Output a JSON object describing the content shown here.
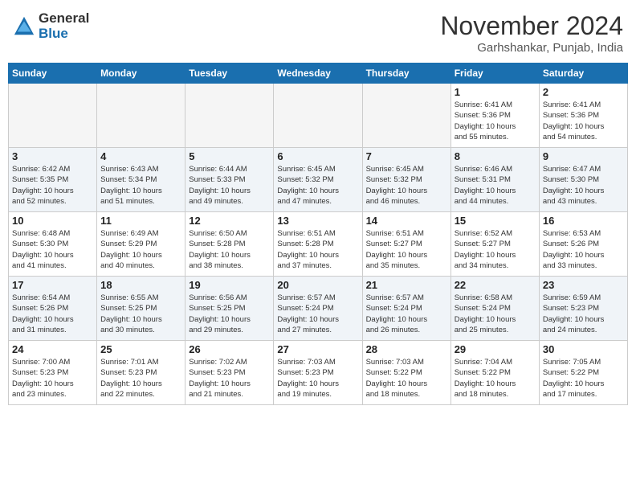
{
  "header": {
    "logo_general": "General",
    "logo_blue": "Blue",
    "month_title": "November 2024",
    "location": "Garhshankar, Punjab, India"
  },
  "weekdays": [
    "Sunday",
    "Monday",
    "Tuesday",
    "Wednesday",
    "Thursday",
    "Friday",
    "Saturday"
  ],
  "weeks": [
    {
      "style": "odd",
      "days": [
        {
          "num": "",
          "info": "",
          "empty": true
        },
        {
          "num": "",
          "info": "",
          "empty": true
        },
        {
          "num": "",
          "info": "",
          "empty": true
        },
        {
          "num": "",
          "info": "",
          "empty": true
        },
        {
          "num": "",
          "info": "",
          "empty": true
        },
        {
          "num": "1",
          "info": "Sunrise: 6:41 AM\nSunset: 5:36 PM\nDaylight: 10 hours\nand 55 minutes.",
          "empty": false
        },
        {
          "num": "2",
          "info": "Sunrise: 6:41 AM\nSunset: 5:36 PM\nDaylight: 10 hours\nand 54 minutes.",
          "empty": false
        }
      ]
    },
    {
      "style": "even",
      "days": [
        {
          "num": "3",
          "info": "Sunrise: 6:42 AM\nSunset: 5:35 PM\nDaylight: 10 hours\nand 52 minutes.",
          "empty": false
        },
        {
          "num": "4",
          "info": "Sunrise: 6:43 AM\nSunset: 5:34 PM\nDaylight: 10 hours\nand 51 minutes.",
          "empty": false
        },
        {
          "num": "5",
          "info": "Sunrise: 6:44 AM\nSunset: 5:33 PM\nDaylight: 10 hours\nand 49 minutes.",
          "empty": false
        },
        {
          "num": "6",
          "info": "Sunrise: 6:45 AM\nSunset: 5:32 PM\nDaylight: 10 hours\nand 47 minutes.",
          "empty": false
        },
        {
          "num": "7",
          "info": "Sunrise: 6:45 AM\nSunset: 5:32 PM\nDaylight: 10 hours\nand 46 minutes.",
          "empty": false
        },
        {
          "num": "8",
          "info": "Sunrise: 6:46 AM\nSunset: 5:31 PM\nDaylight: 10 hours\nand 44 minutes.",
          "empty": false
        },
        {
          "num": "9",
          "info": "Sunrise: 6:47 AM\nSunset: 5:30 PM\nDaylight: 10 hours\nand 43 minutes.",
          "empty": false
        }
      ]
    },
    {
      "style": "odd",
      "days": [
        {
          "num": "10",
          "info": "Sunrise: 6:48 AM\nSunset: 5:30 PM\nDaylight: 10 hours\nand 41 minutes.",
          "empty": false
        },
        {
          "num": "11",
          "info": "Sunrise: 6:49 AM\nSunset: 5:29 PM\nDaylight: 10 hours\nand 40 minutes.",
          "empty": false
        },
        {
          "num": "12",
          "info": "Sunrise: 6:50 AM\nSunset: 5:28 PM\nDaylight: 10 hours\nand 38 minutes.",
          "empty": false
        },
        {
          "num": "13",
          "info": "Sunrise: 6:51 AM\nSunset: 5:28 PM\nDaylight: 10 hours\nand 37 minutes.",
          "empty": false
        },
        {
          "num": "14",
          "info": "Sunrise: 6:51 AM\nSunset: 5:27 PM\nDaylight: 10 hours\nand 35 minutes.",
          "empty": false
        },
        {
          "num": "15",
          "info": "Sunrise: 6:52 AM\nSunset: 5:27 PM\nDaylight: 10 hours\nand 34 minutes.",
          "empty": false
        },
        {
          "num": "16",
          "info": "Sunrise: 6:53 AM\nSunset: 5:26 PM\nDaylight: 10 hours\nand 33 minutes.",
          "empty": false
        }
      ]
    },
    {
      "style": "even",
      "days": [
        {
          "num": "17",
          "info": "Sunrise: 6:54 AM\nSunset: 5:26 PM\nDaylight: 10 hours\nand 31 minutes.",
          "empty": false
        },
        {
          "num": "18",
          "info": "Sunrise: 6:55 AM\nSunset: 5:25 PM\nDaylight: 10 hours\nand 30 minutes.",
          "empty": false
        },
        {
          "num": "19",
          "info": "Sunrise: 6:56 AM\nSunset: 5:25 PM\nDaylight: 10 hours\nand 29 minutes.",
          "empty": false
        },
        {
          "num": "20",
          "info": "Sunrise: 6:57 AM\nSunset: 5:24 PM\nDaylight: 10 hours\nand 27 minutes.",
          "empty": false
        },
        {
          "num": "21",
          "info": "Sunrise: 6:57 AM\nSunset: 5:24 PM\nDaylight: 10 hours\nand 26 minutes.",
          "empty": false
        },
        {
          "num": "22",
          "info": "Sunrise: 6:58 AM\nSunset: 5:24 PM\nDaylight: 10 hours\nand 25 minutes.",
          "empty": false
        },
        {
          "num": "23",
          "info": "Sunrise: 6:59 AM\nSunset: 5:23 PM\nDaylight: 10 hours\nand 24 minutes.",
          "empty": false
        }
      ]
    },
    {
      "style": "odd",
      "days": [
        {
          "num": "24",
          "info": "Sunrise: 7:00 AM\nSunset: 5:23 PM\nDaylight: 10 hours\nand 23 minutes.",
          "empty": false
        },
        {
          "num": "25",
          "info": "Sunrise: 7:01 AM\nSunset: 5:23 PM\nDaylight: 10 hours\nand 22 minutes.",
          "empty": false
        },
        {
          "num": "26",
          "info": "Sunrise: 7:02 AM\nSunset: 5:23 PM\nDaylight: 10 hours\nand 21 minutes.",
          "empty": false
        },
        {
          "num": "27",
          "info": "Sunrise: 7:03 AM\nSunset: 5:23 PM\nDaylight: 10 hours\nand 19 minutes.",
          "empty": false
        },
        {
          "num": "28",
          "info": "Sunrise: 7:03 AM\nSunset: 5:22 PM\nDaylight: 10 hours\nand 18 minutes.",
          "empty": false
        },
        {
          "num": "29",
          "info": "Sunrise: 7:04 AM\nSunset: 5:22 PM\nDaylight: 10 hours\nand 18 minutes.",
          "empty": false
        },
        {
          "num": "30",
          "info": "Sunrise: 7:05 AM\nSunset: 5:22 PM\nDaylight: 10 hours\nand 17 minutes.",
          "empty": false
        }
      ]
    }
  ]
}
